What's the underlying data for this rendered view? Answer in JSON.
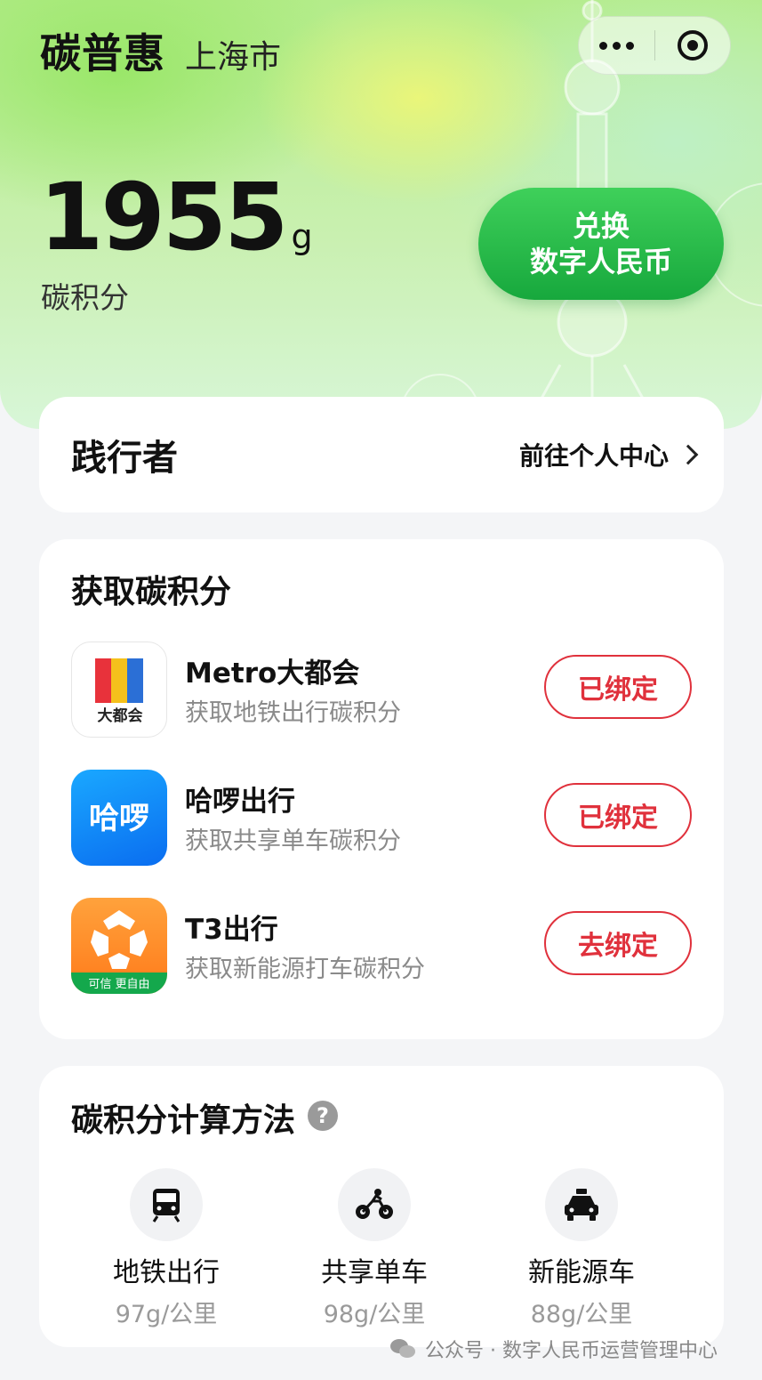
{
  "header": {
    "title": "碳普惠",
    "city": "上海市"
  },
  "capsule": {
    "more_icon": "more-dots-icon",
    "close_icon": "target-icon"
  },
  "points": {
    "value": "1955",
    "unit": "g",
    "label": "碳积分"
  },
  "exchange": {
    "line1": "兑换",
    "line2": "数字人民币",
    "color": "#1fb344"
  },
  "user": {
    "name": "践行者",
    "link": "前往个人中心"
  },
  "earn": {
    "title": "获取碳积分",
    "items": [
      {
        "name": "Metro大都会",
        "desc": "获取地铁出行碳积分",
        "button": "已绑定",
        "icon_text": "大都会"
      },
      {
        "name": "哈啰出行",
        "desc": "获取共享单车碳积分",
        "button": "已绑定",
        "icon_text": "哈啰"
      },
      {
        "name": "T3出行",
        "desc": "获取新能源打车碳积分",
        "button": "去绑定",
        "icon_text": "可信 更自由"
      }
    ]
  },
  "calc": {
    "title": "碳积分计算方法",
    "help": "?",
    "items": [
      {
        "name": "地铁出行",
        "rate": "97g/公里",
        "icon": "subway-icon"
      },
      {
        "name": "共享单车",
        "rate": "98g/公里",
        "icon": "bicycle-icon"
      },
      {
        "name": "新能源车",
        "rate": "88g/公里",
        "icon": "taxi-icon"
      }
    ]
  },
  "watermark": "公众号 · 数字人民币运营管理中心",
  "colors": {
    "accent_red": "#e0313c",
    "accent_green": "#1fb344"
  }
}
